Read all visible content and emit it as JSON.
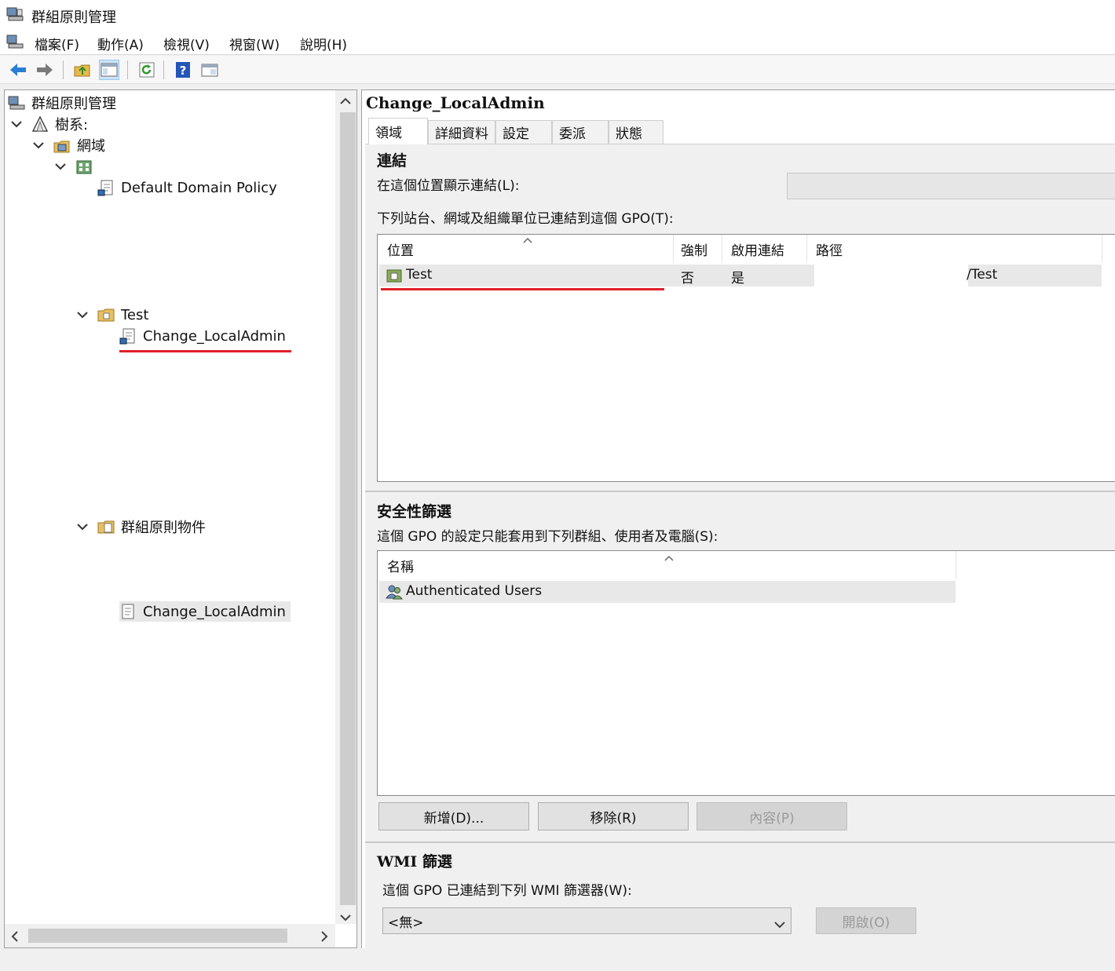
{
  "window": {
    "title": "群組原則管理"
  },
  "menu": [
    "檔案(F)",
    "動作(A)",
    "檢視(V)",
    "視窗(W)",
    "說明(H)"
  ],
  "toolbar": {
    "icons": [
      "back-arrow-icon",
      "forward-arrow-icon",
      "up-folder-icon",
      "show-hide-tree-icon",
      "refresh-icon",
      "help-icon",
      "console-view-icon"
    ]
  },
  "tree": {
    "root": "群組原則管理",
    "forest": "樹系:",
    "domains": "網域",
    "domain_node": "",
    "default_policy": "Default Domain Policy",
    "ou_test": "Test",
    "ou_link": "Change_LocalAdmin",
    "gpo_container": "群組原則物件",
    "gpo_item": "Change_LocalAdmin"
  },
  "detail": {
    "gpo_name": "Change_LocalAdmin",
    "tabs": [
      "領域",
      "詳細資料",
      "設定",
      "委派",
      "狀態"
    ],
    "selected_tab": "領域",
    "links_section": {
      "heading": "連結",
      "location_label": "在這個位置顯示連結(L):",
      "location_value": "",
      "table_caption": "下列站台、網域及組織單位已連結到這個 GPO(T):",
      "columns": [
        "位置",
        "強制",
        "啟用連結",
        "路徑"
      ],
      "rows": [
        {
          "location": "Test",
          "enforced": "否",
          "link_enabled": "是",
          "path": "/Test"
        }
      ]
    },
    "security_section": {
      "heading": "安全性篩選",
      "caption": "這個 GPO 的設定只能套用到下列群組、使用者及電腦(S):",
      "column": "名稱",
      "rows": [
        "Authenticated Users"
      ],
      "add_button": "新增(D)...",
      "remove_button": "移除(R)",
      "properties_button": "內容(P)"
    },
    "wmi_section": {
      "heading": "WMI 篩選",
      "caption": "這個 GPO 已連結到下列 WMI 篩選器(W):",
      "selected_filter": "<無>",
      "open_button": "開啟(O)"
    }
  },
  "colors": {
    "highlight_underline": "#e0202a",
    "selection": "#e8e8e8"
  }
}
